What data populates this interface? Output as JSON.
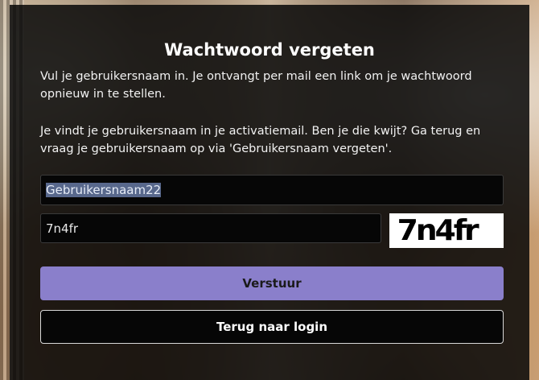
{
  "dialog": {
    "title": "Wachtwoord vergeten",
    "paragraph1": "Vul je gebruikersnaam in. Je ontvangt per mail een link om je wachtwoord opnieuw in te stellen.",
    "paragraph2": "Je vindt je gebruikersnaam in je activatiemail. Ben je die kwijt? Ga terug en vraag je gebruikersnaam op via 'Gebruikersnaam vergeten'."
  },
  "form": {
    "username_value": "Gebruikersnaam22",
    "captcha_value": "7n4fr",
    "captcha_image_text": "7n4fr",
    "submit_label": "Verstuur",
    "back_label": "Terug naar login"
  },
  "colors": {
    "primary_button": "#8a7fcb",
    "modal_background": "#080808",
    "selection": "#58688c"
  }
}
